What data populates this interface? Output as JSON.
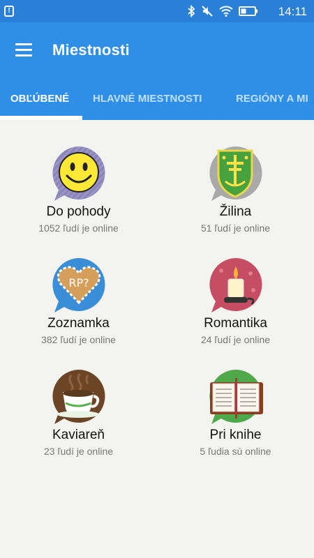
{
  "status_bar": {
    "time": "14:11",
    "icons": [
      "alert-icon",
      "bluetooth-icon",
      "mute-icon",
      "wifi-icon",
      "battery-icon"
    ]
  },
  "app_bar": {
    "title": "Miestnosti"
  },
  "tabs": [
    {
      "label": "OBĽÚBENÉ",
      "active": true
    },
    {
      "label": "HLAVNÉ MIESTNOSTI",
      "active": false
    },
    {
      "label": "REGIÓNY A MI",
      "active": false
    }
  ],
  "rooms": [
    {
      "name": "Do pohody",
      "online": "1052 ľudí je online",
      "icon": "smiley-icon"
    },
    {
      "name": "Žilina",
      "online": "51 ľudí je online",
      "icon": "zilina-coat-of-arms-icon"
    },
    {
      "name": "Zoznamka",
      "online": "382 ľudí je online",
      "icon": "heart-cookie-icon",
      "icon_text": "RP?"
    },
    {
      "name": "Romantika",
      "online": "24 ľudí je online",
      "icon": "candle-icon"
    },
    {
      "name": "Kaviareň",
      "online": "23 ľudí je online",
      "icon": "coffee-cup-icon"
    },
    {
      "name": "Pri knihe",
      "online": "5 ľudia sú online",
      "icon": "open-book-icon"
    }
  ],
  "colors": {
    "status_bar": "#2a7fd6",
    "app_bar": "#2f8ee5",
    "background": "#f3f3ef",
    "tab_inactive": "#bfe0ff"
  }
}
